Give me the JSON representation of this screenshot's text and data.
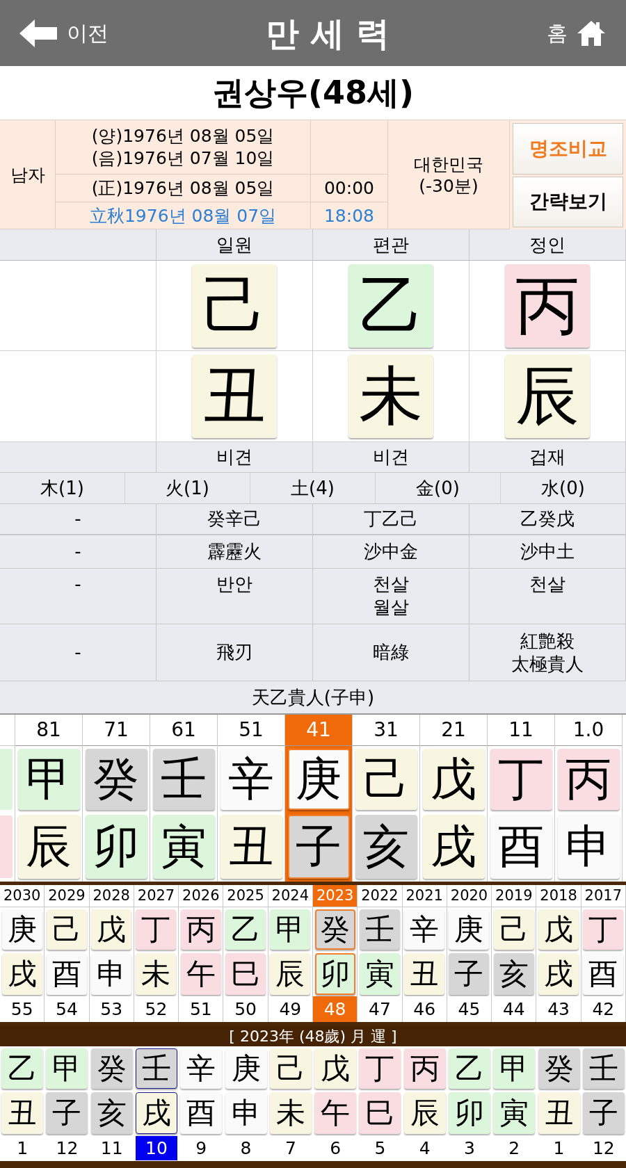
{
  "header": {
    "back_label": "이전",
    "title": "만 세 력",
    "home_label": "홈"
  },
  "person": {
    "title": "권상우(48세)"
  },
  "info": {
    "gender": "남자",
    "solar": "(양)1976년 08월 05일",
    "lunar": "(음)1976년 07월 10일",
    "corrected": "(正)1976년 08월 05일",
    "corrected_time": "00:00",
    "term": "立秋1976년 08월 07일",
    "term_time": "18:08",
    "country": "대한민국",
    "offset": "(-30분)"
  },
  "buttons": [
    {
      "label": "명조비교",
      "kind": "accent"
    },
    {
      "label": "간략보기",
      "kind": "plain"
    }
  ],
  "pillars": [
    {
      "ten_god": "일원",
      "stem": {
        "char": "己",
        "color": "#f8f6e0"
      },
      "branch": {
        "char": "丑",
        "color": "#f8f6e0"
      },
      "branch_ten_god": "비견"
    },
    {
      "ten_god": "편관",
      "stem": {
        "char": "乙",
        "color": "#dcf6dc"
      },
      "branch": {
        "char": "未",
        "color": "#f8f6e0"
      },
      "branch_ten_god": "비견"
    },
    {
      "ten_god": "정인",
      "stem": {
        "char": "丙",
        "color": "#f9dde1"
      },
      "branch": {
        "char": "辰",
        "color": "#f8f6e0"
      },
      "branch_ten_god": "겁재"
    }
  ],
  "elements": [
    "木(1)",
    "火(1)",
    "土(4)",
    "金(0)",
    "水(0)"
  ],
  "info_rows": [
    {
      "kind": "hidden_stems",
      "cells": [
        [
          "-"
        ],
        [
          "癸辛己"
        ],
        [
          "丁乙己"
        ],
        [
          "乙癸戊"
        ]
      ]
    },
    {
      "kind": "napeum",
      "cells": [
        [
          "-"
        ],
        [
          "霹靂火"
        ],
        [
          "沙中金"
        ],
        [
          "沙中土"
        ]
      ]
    },
    {
      "kind": "twelve_shinsal",
      "cells": [
        [
          "-"
        ],
        [
          "반안"
        ],
        [
          "천살",
          "월살"
        ],
        [
          "천살"
        ]
      ]
    },
    {
      "kind": "shinsal",
      "cells": [
        [
          "-"
        ],
        [
          "飛刃"
        ],
        [
          "暗綠"
        ],
        [
          "紅艶殺",
          "太極貴人"
        ]
      ]
    }
  ],
  "noble": "天乙貴人(子申)",
  "daewoon": {
    "partial": {
      "stem": {
        "color": "#dcf6dc"
      },
      "branch": {
        "color": "#f9dde1"
      }
    },
    "columns": [
      {
        "age": "81",
        "stem": {
          "char": "甲",
          "color": "#dcf6dc"
        },
        "branch": {
          "char": "辰",
          "color": "#f8f6e0"
        },
        "selected": false
      },
      {
        "age": "71",
        "stem": {
          "char": "癸",
          "color": "#d6d6d6"
        },
        "branch": {
          "char": "卯",
          "color": "#dcf6dc"
        },
        "selected": false
      },
      {
        "age": "61",
        "stem": {
          "char": "壬",
          "color": "#d6d6d6"
        },
        "branch": {
          "char": "寅",
          "color": "#dcf6dc"
        },
        "selected": false
      },
      {
        "age": "51",
        "stem": {
          "char": "辛",
          "color": "#fafafa"
        },
        "branch": {
          "char": "丑",
          "color": "#f8f6e0"
        },
        "selected": false
      },
      {
        "age": "41",
        "stem": {
          "char": "庚",
          "color": "#fafafa"
        },
        "branch": {
          "char": "子",
          "color": "#d6d6d6"
        },
        "selected": true
      },
      {
        "age": "31",
        "stem": {
          "char": "己",
          "color": "#f8f6e0"
        },
        "branch": {
          "char": "亥",
          "color": "#d6d6d6"
        },
        "selected": false
      },
      {
        "age": "21",
        "stem": {
          "char": "戊",
          "color": "#f8f6e0"
        },
        "branch": {
          "char": "戌",
          "color": "#f8f6e0"
        },
        "selected": false
      },
      {
        "age": "11",
        "stem": {
          "char": "丁",
          "color": "#f9dde1"
        },
        "branch": {
          "char": "酉",
          "color": "#fafafa"
        },
        "selected": false
      },
      {
        "age": "1.0",
        "stem": {
          "char": "丙",
          "color": "#f9dde1"
        },
        "branch": {
          "char": "申",
          "color": "#fafafa"
        },
        "selected": false
      }
    ]
  },
  "years": [
    {
      "year": "2030",
      "stem": {
        "char": "庚",
        "color": "#fafafa"
      },
      "branch": {
        "char": "戌",
        "color": "#f8f6e0"
      },
      "age": "55",
      "selected": false
    },
    {
      "year": "2029",
      "stem": {
        "char": "己",
        "color": "#f8f6e0"
      },
      "branch": {
        "char": "酉",
        "color": "#fafafa"
      },
      "age": "54",
      "selected": false
    },
    {
      "year": "2028",
      "stem": {
        "char": "戊",
        "color": "#f8f6e0"
      },
      "branch": {
        "char": "申",
        "color": "#fafafa"
      },
      "age": "53",
      "selected": false
    },
    {
      "year": "2027",
      "stem": {
        "char": "丁",
        "color": "#f9dde1"
      },
      "branch": {
        "char": "未",
        "color": "#f8f6e0"
      },
      "age": "52",
      "selected": false
    },
    {
      "year": "2026",
      "stem": {
        "char": "丙",
        "color": "#f9dde1"
      },
      "branch": {
        "char": "午",
        "color": "#f9dde1"
      },
      "age": "51",
      "selected": false
    },
    {
      "year": "2025",
      "stem": {
        "char": "乙",
        "color": "#dcf6dc"
      },
      "branch": {
        "char": "巳",
        "color": "#f9dde1"
      },
      "age": "50",
      "selected": false
    },
    {
      "year": "2024",
      "stem": {
        "char": "甲",
        "color": "#dcf6dc"
      },
      "branch": {
        "char": "辰",
        "color": "#f8f6e0"
      },
      "age": "49",
      "selected": false
    },
    {
      "year": "2023",
      "stem": {
        "char": "癸",
        "color": "#d6d6d6"
      },
      "branch": {
        "char": "卯",
        "color": "#dcf6dc"
      },
      "age": "48",
      "selected": true
    },
    {
      "year": "2022",
      "stem": {
        "char": "壬",
        "color": "#d6d6d6"
      },
      "branch": {
        "char": "寅",
        "color": "#dcf6dc"
      },
      "age": "47",
      "selected": false
    },
    {
      "year": "2021",
      "stem": {
        "char": "辛",
        "color": "#fafafa"
      },
      "branch": {
        "char": "丑",
        "color": "#f8f6e0"
      },
      "age": "46",
      "selected": false
    },
    {
      "year": "2020",
      "stem": {
        "char": "庚",
        "color": "#fafafa"
      },
      "branch": {
        "char": "子",
        "color": "#d6d6d6"
      },
      "age": "45",
      "selected": false
    },
    {
      "year": "2019",
      "stem": {
        "char": "己",
        "color": "#f8f6e0"
      },
      "branch": {
        "char": "亥",
        "color": "#d6d6d6"
      },
      "age": "44",
      "selected": false
    },
    {
      "year": "2018",
      "stem": {
        "char": "戊",
        "color": "#f8f6e0"
      },
      "branch": {
        "char": "戌",
        "color": "#f8f6e0"
      },
      "age": "43",
      "selected": false
    },
    {
      "year": "2017",
      "stem": {
        "char": "丁",
        "color": "#f9dde1"
      },
      "branch": {
        "char": "酉",
        "color": "#fafafa"
      },
      "age": "42",
      "selected": false
    }
  ],
  "month_banner": "[ 2023年 (48歲) 月 運 ]",
  "months": [
    {
      "month": "1",
      "stem": {
        "char": "乙",
        "color": "#dcf6dc"
      },
      "branch": {
        "char": "丑",
        "color": "#f8f6e0"
      },
      "selected": false
    },
    {
      "month": "12",
      "stem": {
        "char": "甲",
        "color": "#dcf6dc"
      },
      "branch": {
        "char": "子",
        "color": "#d6d6d6"
      },
      "selected": false
    },
    {
      "month": "11",
      "stem": {
        "char": "癸",
        "color": "#d6d6d6"
      },
      "branch": {
        "char": "亥",
        "color": "#d6d6d6"
      },
      "selected": false
    },
    {
      "month": "10",
      "stem": {
        "char": "壬",
        "color": "#d6d6d6"
      },
      "branch": {
        "char": "戌",
        "color": "#f8f6e0"
      },
      "selected": true
    },
    {
      "month": "9",
      "stem": {
        "char": "辛",
        "color": "#fafafa"
      },
      "branch": {
        "char": "酉",
        "color": "#fafafa"
      },
      "selected": false
    },
    {
      "month": "8",
      "stem": {
        "char": "庚",
        "color": "#fafafa"
      },
      "branch": {
        "char": "申",
        "color": "#fafafa"
      },
      "selected": false
    },
    {
      "month": "7",
      "stem": {
        "char": "己",
        "color": "#f8f6e0"
      },
      "branch": {
        "char": "未",
        "color": "#f8f6e0"
      },
      "selected": false
    },
    {
      "month": "6",
      "stem": {
        "char": "戊",
        "color": "#f8f6e0"
      },
      "branch": {
        "char": "午",
        "color": "#f9dde1"
      },
      "selected": false
    },
    {
      "month": "5",
      "stem": {
        "char": "丁",
        "color": "#f9dde1"
      },
      "branch": {
        "char": "巳",
        "color": "#f9dde1"
      },
      "selected": false
    },
    {
      "month": "4",
      "stem": {
        "char": "丙",
        "color": "#f9dde1"
      },
      "branch": {
        "char": "辰",
        "color": "#f8f6e0"
      },
      "selected": false
    },
    {
      "month": "3",
      "stem": {
        "char": "乙",
        "color": "#dcf6dc"
      },
      "branch": {
        "char": "卯",
        "color": "#dcf6dc"
      },
      "selected": false
    },
    {
      "month": "2",
      "stem": {
        "char": "甲",
        "color": "#dcf6dc"
      },
      "branch": {
        "char": "寅",
        "color": "#dcf6dc"
      },
      "selected": false
    },
    {
      "month": "1",
      "stem": {
        "char": "癸",
        "color": "#d6d6d6"
      },
      "branch": {
        "char": "丑",
        "color": "#f8f6e0"
      },
      "selected": false
    },
    {
      "month": "12",
      "stem": {
        "char": "壬",
        "color": "#d6d6d6"
      },
      "branch": {
        "char": "子",
        "color": "#d6d6d6"
      },
      "selected": false
    }
  ]
}
